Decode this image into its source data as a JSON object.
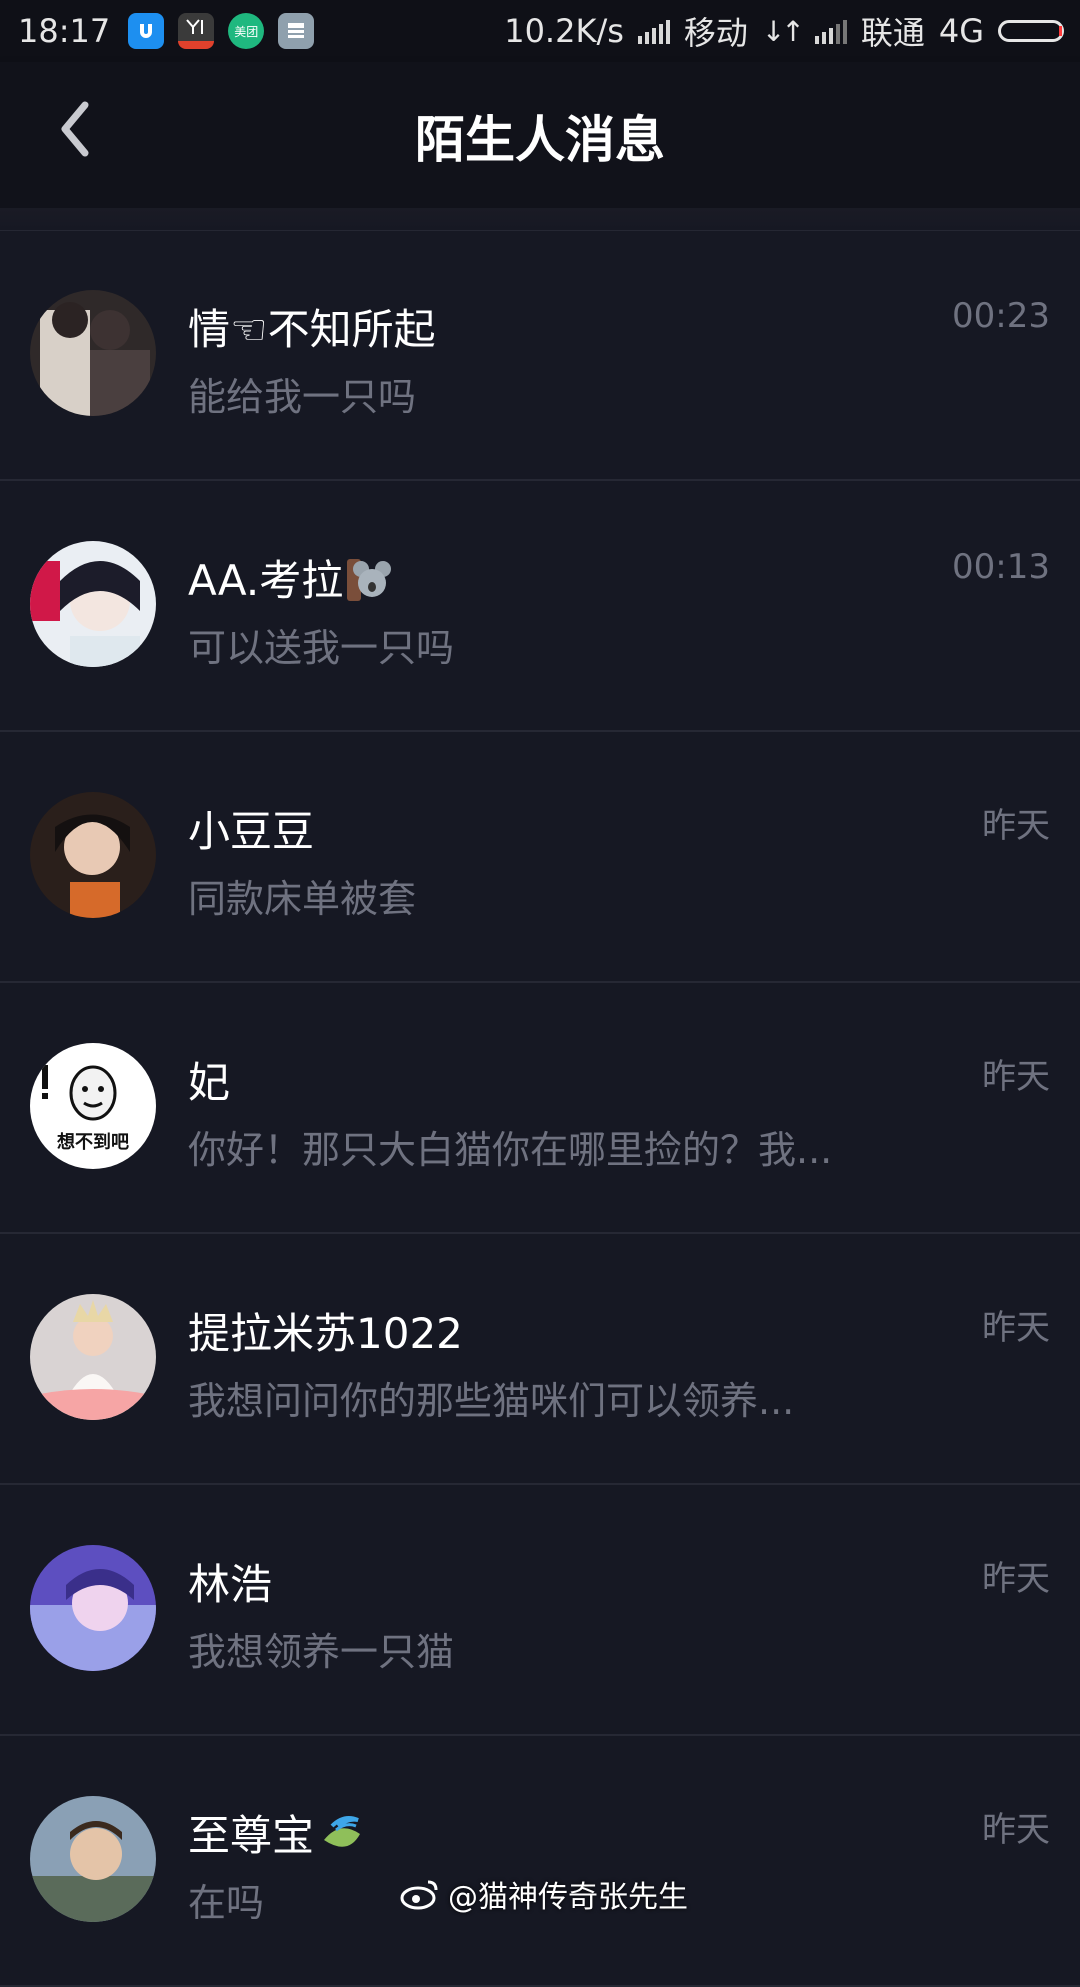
{
  "status_bar": {
    "time": "18:17",
    "network_speed": "10.2K/s",
    "carrier1": "移动",
    "carrier2": "联通",
    "network_type": "4G",
    "apps": [
      {
        "icon": "app-u-icon",
        "color": "#1d8ff0",
        "label": ""
      },
      {
        "icon": "app-yi-icon",
        "color": "#3a3a3a",
        "label": ""
      },
      {
        "icon": "app-meituan-icon",
        "color": "#1fb87f",
        "label": "美团"
      },
      {
        "icon": "app-grey-icon",
        "color": "#8fa0ad",
        "label": ""
      }
    ]
  },
  "header": {
    "title": "陌生人消息",
    "back_icon": "chevron-left-icon"
  },
  "messages": [
    {
      "name": "情☜不知所起",
      "preview": "能给我一只吗",
      "time": "00:23",
      "avatar_colors": [
        "#3a3030",
        "#d9d2cc"
      ]
    },
    {
      "name": "AA.考拉",
      "name_emoji": "koala-icon",
      "preview": "可以送我一只吗",
      "time": "00:13",
      "avatar_colors": [
        "#e8ecf2",
        "#c9174a"
      ]
    },
    {
      "name": "小豆豆",
      "preview": "同款床单被套",
      "time": "昨天",
      "avatar_colors": [
        "#2a1e1a",
        "#c99a7f"
      ]
    },
    {
      "name": "妃",
      "preview": "你好！那只大白猫你在哪里捡的？我...",
      "time": "昨天",
      "avatar_colors": [
        "#ffffff",
        "#111111"
      ],
      "avatar_text": "想不到吧"
    },
    {
      "name": "提拉米苏1022",
      "preview": " 我想问问你的那些猫咪们可以领养...",
      "time": "昨天",
      "avatar_colors": [
        "#d6cfcf",
        "#f2d9c8"
      ]
    },
    {
      "name": "林浩",
      "preview": "我想领养一只猫",
      "time": "昨天",
      "avatar_colors": [
        "#6a5acd",
        "#e9c7f2"
      ]
    },
    {
      "name": "至尊宝",
      "name_emoji": "leaf-swirl-icon",
      "preview": "在吗",
      "time": "昨天",
      "avatar_colors": [
        "#7a90a6",
        "#c8b39a"
      ]
    }
  ],
  "watermark": {
    "text": "@猫神传奇张先生",
    "icon": "weibo-icon"
  }
}
